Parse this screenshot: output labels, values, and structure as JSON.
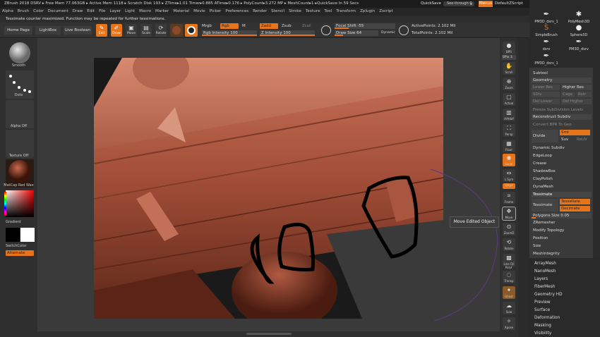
{
  "titlebar": {
    "status": "ZBrush 2018   DSRV   ▸ Free Mem 77.063GB ▸ Active Mem 1118 ▸ Scratch Disk 193 ▸  ZTime▸1.01 Timer▸0.885 ATime▸0.176 ▸ PolyCount▸3.272 MP ▸ MeshCount▸1  ▸QuickSave In 59 Secs",
    "quicksave": "QuickSave",
    "seethrough": "See-through  0",
    "menus": "Menus",
    "default_script": "DefaultZScript"
  },
  "menubar": [
    "Alpha",
    "Brush",
    "Color",
    "Document",
    "Draw",
    "Edit",
    "File",
    "Layer",
    "Light",
    "Macro",
    "Marker",
    "Material",
    "Movie",
    "Picker",
    "Preferences",
    "Render",
    "Stencil",
    "Stroke",
    "Texture",
    "Tool",
    "Transform",
    "Zplugin",
    "Zscript"
  ],
  "note": "Tessimate counter maximized. Function may be repeated for further tessimations.",
  "toolrow": {
    "home": "Home Page",
    "lightbox": "LightBox",
    "liveboolean": "Live Boolean",
    "edit": "Edit",
    "draw": "Draw",
    "move": "Move",
    "scale": "Scale",
    "rotate": "Rotate",
    "mrgb": "Mrgb",
    "rgb": "Rgb",
    "m": "M",
    "zadd": "Zadd",
    "zsub": "Zsub",
    "zcut": "Zcut",
    "rgb_intensity": "Rgb Intensity 100",
    "z_intensity": "Z Intensity 100",
    "focal_shift": "Focal Shift -55",
    "draw_size": "Draw Size 64",
    "dynamic": "Dynamic",
    "active_points": "ActivePoints: 2.102 Mil",
    "total_points": "TotalPoints: 2.102 Mil"
  },
  "leftshelf": {
    "brush_label": "Smooth",
    "stroke_label": "Dots",
    "alpha_label": "Alpha Off",
    "texture_label": "Texture Off",
    "material_label": "MatCap Red Wax",
    "gradient_label": "Gradient",
    "switch_label": "SwitchColor",
    "alternate_label": "Alternate"
  },
  "rightshelf": [
    {
      "name": "bpr",
      "label": "BPR"
    },
    {
      "name": "spix",
      "label": "SPix 3"
    },
    {
      "name": "scroll",
      "label": "Scroll"
    },
    {
      "name": "zoom",
      "label": "Zoom"
    },
    {
      "name": "actual",
      "label": "Actual"
    },
    {
      "name": "aahalf",
      "label": "AAHalf"
    },
    {
      "name": "persp",
      "label": "Persp"
    },
    {
      "name": "floor",
      "label": "Floor"
    },
    {
      "name": "local",
      "label": "Local"
    },
    {
      "name": "lsym",
      "label": "L.Sym"
    },
    {
      "name": "xyz",
      "label": "Qxyz"
    },
    {
      "name": "frame",
      "label": "Frame"
    },
    {
      "name": "move",
      "label": "Move"
    },
    {
      "name": "zoom3d",
      "label": "ZoomD"
    },
    {
      "name": "rotate",
      "label": "Rotate"
    },
    {
      "name": "linefill",
      "label": "Line Fill PolyF"
    },
    {
      "name": "transp",
      "label": "Transp"
    },
    {
      "name": "ghost",
      "label": "Ghost"
    },
    {
      "name": "solo",
      "label": "Solo"
    },
    {
      "name": "xpose",
      "label": "Xpose"
    }
  ],
  "tooltip": "Move Edited Object",
  "brushes": [
    {
      "name": "PM3D_dsrv_1",
      "icon": "pen-icon"
    },
    {
      "name": "PolyMesh3D",
      "icon": "star-icon"
    },
    {
      "name": "SimpleBrush",
      "icon": "s-brush-icon"
    },
    {
      "name": "Sphere3D",
      "icon": "sphere-icon"
    },
    {
      "name": "dsrv",
      "icon": "pen-icon"
    },
    {
      "name": "PM3D_dsrv",
      "icon": "pen-icon"
    },
    {
      "name": "PM3D_dsrv_1",
      "icon": "pen-icon"
    }
  ],
  "subtool_palette": {
    "subtool": "Subtool",
    "geometry": "Geometry",
    "lower_res": "Lower Res",
    "higher_res": "Higher Res",
    "sdiv": "SDiv",
    "cage": "Cage",
    "rstr": "Rstr",
    "del_lower": "Del Lower",
    "del_higher": "Del Higher",
    "freeze": "Freeze SubDivision Levels",
    "reconstruct": "Reconstruct Subdiv",
    "convert_bpr": "Convert BPR To Geo",
    "divide": "Divide",
    "smt": "Smt",
    "suv": "Suv",
    "reuv": "ReUV",
    "dynamic_subdiv": "Dynamic Subdiv",
    "edgeloop": "EdgeLoop",
    "crease": "Crease",
    "shadowbox": "ShadowBox",
    "claypolish": "ClayPolish",
    "dynamesh": "DynaMesh",
    "tessimate": "Tessimate",
    "tessimate_btn": "Tessimate",
    "tessellate": "Tessellate",
    "decimate": "Decimate",
    "polygons_size": "Polygons Size 0.05",
    "zremesher": "ZRemesher",
    "modify_topology": "Modify Topology",
    "position": "Position",
    "size": "Size",
    "meshintegrity": "MeshIntegrity"
  },
  "palette_list": [
    "ArrayMesh",
    "NanoMesh",
    "Layers",
    "FiberMesh",
    "Geometry HD",
    "Preview",
    "Surface",
    "Deformation",
    "Masking",
    "Visibility"
  ]
}
